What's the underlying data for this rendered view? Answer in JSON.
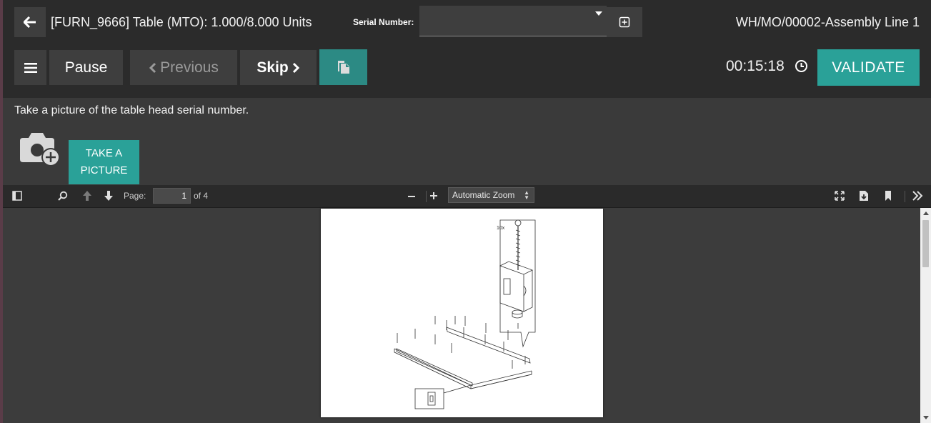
{
  "header": {
    "title": "[FURN_9666] Table (MTO): 1.000/8.000 Units",
    "serial_label": "Serial Number:",
    "serial_value": "",
    "workorder": "WH/MO/00002-Assembly Line 1"
  },
  "actions": {
    "pause": "Pause",
    "previous": "Previous",
    "skip": "Skip",
    "timer": "00:15:18",
    "validate": "VALIDATE"
  },
  "step": {
    "instruction": "Take a picture of the table head serial number.",
    "take_picture_line1": "TAKE A",
    "take_picture_line2": "PICTURE"
  },
  "pdf": {
    "page_label": "Page:",
    "page_value": "1",
    "page_of": "of 4",
    "zoom": "Automatic Zoom",
    "drawing_quantity": "10x"
  },
  "icons": [
    "back-arrow-icon",
    "plus-square-icon",
    "hamburger-icon",
    "chevron-left-icon",
    "chevron-right-icon",
    "document-icon",
    "clock-icon",
    "camera-plus-icon",
    "sidebar-toggle-icon",
    "search-icon",
    "page-up-icon",
    "page-down-icon",
    "zoom-out-icon",
    "zoom-in-icon",
    "fullscreen-icon",
    "download-icon",
    "bookmark-icon",
    "double-chevron-right-icon"
  ],
  "colors": {
    "accent": "#2aa198",
    "doc_button": "#2c8a84",
    "topbar": "#2b2b2b",
    "button": "#3e3e3e"
  }
}
